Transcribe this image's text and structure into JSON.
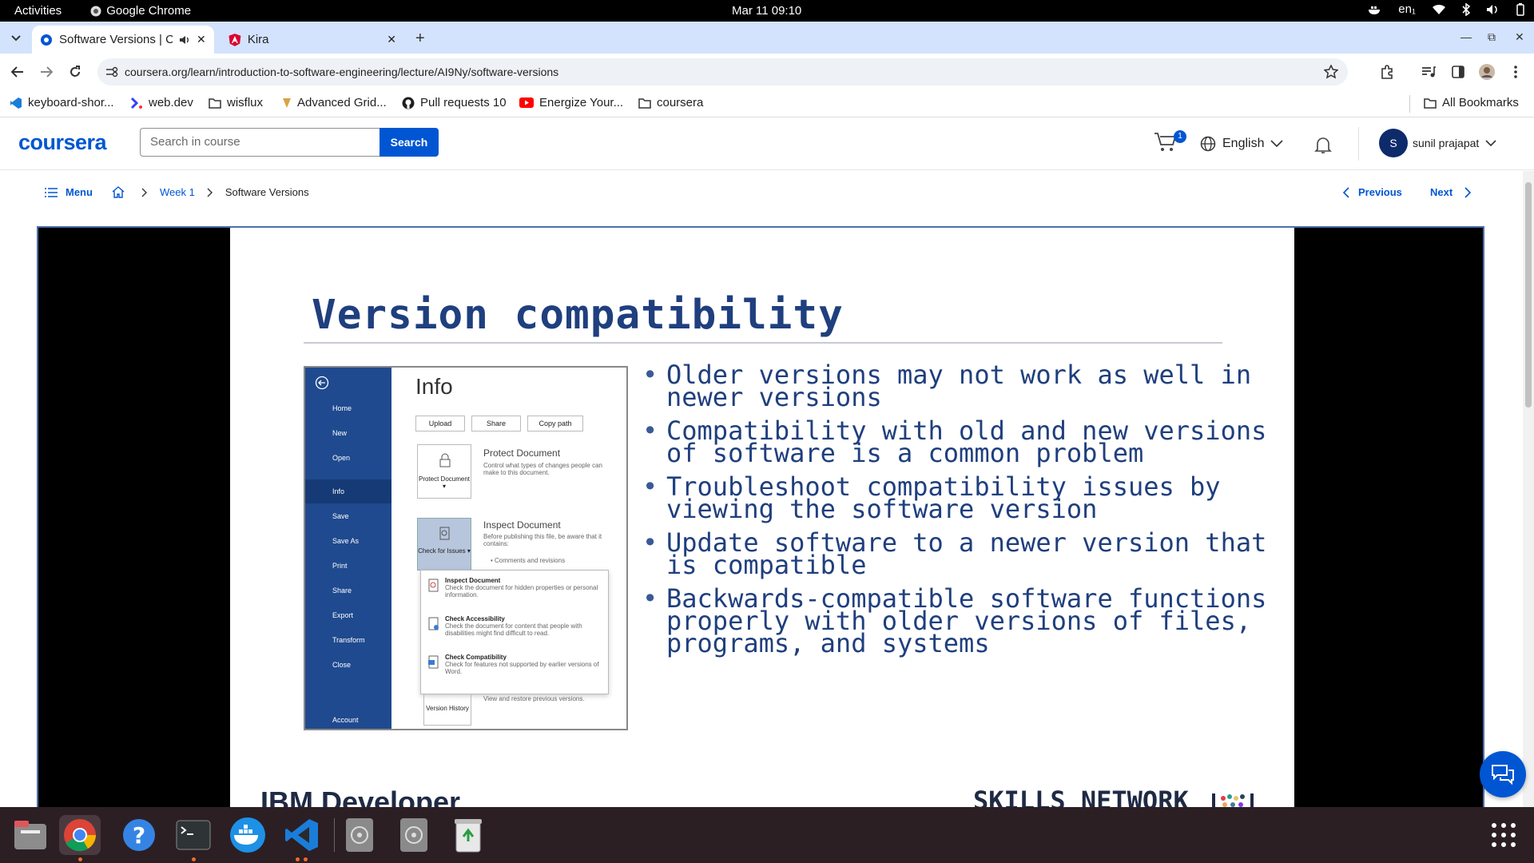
{
  "system_bar": {
    "activities": "Activities",
    "app_name": "Google Chrome",
    "clock": "Mar 11  09:10",
    "input_lang": "en₁"
  },
  "browser": {
    "tabs": [
      {
        "title": "Software Versions | C",
        "active": true
      },
      {
        "title": "Kira",
        "active": false
      }
    ],
    "url": "coursera.org/learn/introduction-to-software-engineering/lecture/AI9Ny/software-versions",
    "bookmarks": [
      {
        "label": "keyboard-shor...",
        "icon": "vscode-icon"
      },
      {
        "label": "web.dev",
        "icon": "webdev-icon"
      },
      {
        "label": "wisflux",
        "icon": "folder-icon"
      },
      {
        "label": "Advanced Grid...",
        "icon": "grid-icon"
      },
      {
        "label": "Pull requests 10",
        "icon": "github-icon"
      },
      {
        "label": "Energize Your...",
        "icon": "youtube-icon"
      },
      {
        "label": "coursera",
        "icon": "folder-icon"
      }
    ],
    "all_bookmarks": "All Bookmarks"
  },
  "coursera": {
    "logo": "coursera",
    "search_placeholder": "Search in course",
    "search_button": "Search",
    "cart_count": "1",
    "language": "English",
    "user_initial": "S",
    "user_name": "sunil prajapat",
    "accent": "#0056d2"
  },
  "nav": {
    "menu": "Menu",
    "week": "Week 1",
    "current": "Software Versions",
    "previous": "Previous",
    "next": "Next"
  },
  "slide": {
    "title": "Version compatibility",
    "bullets": [
      "Older versions may not work as well in newer versions",
      "Compatibility with old and new versions of software is a common problem",
      "Troubleshoot compatibility issues by viewing the software version",
      "Update software to a newer version that is compatible",
      "Backwards-compatible software functions properly with older versions of files, programs, and systems"
    ],
    "footer_left": "IBM Developer",
    "footer_right": "SKILLS NETWORK",
    "word": {
      "sidebar": [
        "Home",
        "New",
        "Open",
        "Info",
        "Save",
        "Save As",
        "Print",
        "Share",
        "Export",
        "Transform",
        "Close",
        "Account"
      ],
      "heading": "Info",
      "buttons": [
        "Upload",
        "Share",
        "Copy path"
      ],
      "protect_btn": "Protect Document ▾",
      "protect_title": "Protect Document",
      "protect_desc": "Control what types of changes people can make to this document.",
      "check_btn": "Check for Issues ▾",
      "inspect_title": "Inspect Document",
      "inspect_desc": "Before publishing this file, be aware that it contains:",
      "inspect_item": "Comments and revisions",
      "menu": [
        {
          "title": "Inspect Document",
          "desc": "Check the document for hidden properties or personal information."
        },
        {
          "title": "Check Accessibility",
          "desc": "Check the document for content that people with disabilities might find difficult to read."
        },
        {
          "title": "Check Compatibility",
          "desc": "Check for features not supported by earlier versions of Word."
        }
      ],
      "version_btn": "Version History",
      "version_desc": "View and restore previous versions."
    }
  }
}
